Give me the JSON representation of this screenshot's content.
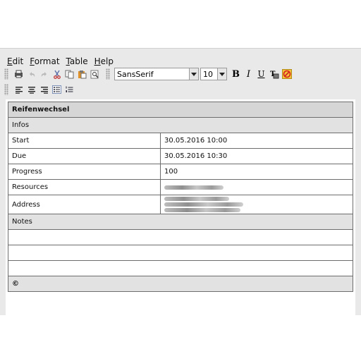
{
  "menu": {
    "items": [
      {
        "first": "E",
        "rest": "dit"
      },
      {
        "first": "F",
        "rest": "ormat"
      },
      {
        "first": "T",
        "rest": "able"
      },
      {
        "first": "H",
        "rest": "elp"
      }
    ]
  },
  "toolbar": {
    "font_family": "SansSerif",
    "font_size": "10",
    "bold": "B",
    "italic": "I",
    "underline": "U"
  },
  "document": {
    "title": "Reifenwechsel",
    "section_infos": "Infos",
    "rows": [
      {
        "label": "Start",
        "value": "30.05.2016 10:00"
      },
      {
        "label": "Due",
        "value": "30.05.2016 10:30"
      },
      {
        "label": "Progress",
        "value": "100"
      },
      {
        "label": "Resources",
        "value": ""
      },
      {
        "label": "Address",
        "value": ""
      }
    ],
    "section_notes": "Notes",
    "footer": "©"
  }
}
